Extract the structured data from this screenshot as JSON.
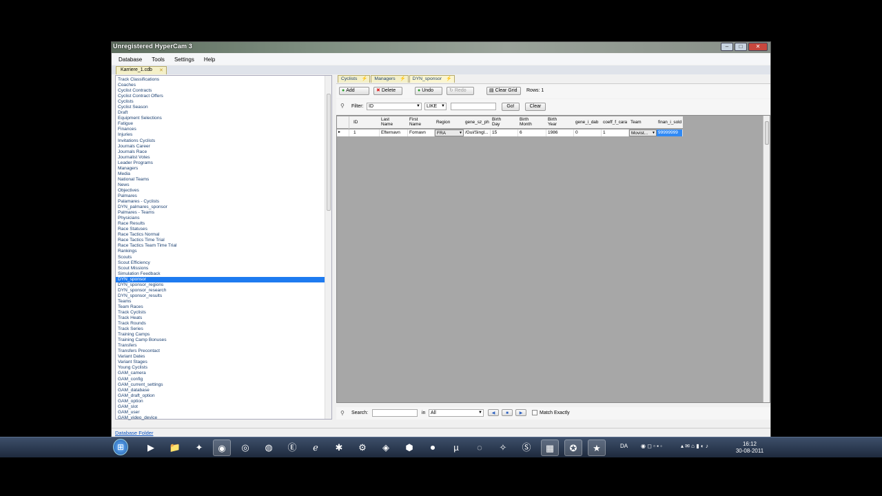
{
  "window": {
    "title": "Unregistered HyperCam 3",
    "caption_minimize": "–",
    "caption_maximize": "□",
    "caption_close": "✕"
  },
  "menu": [
    "Database",
    "Tools",
    "Settings",
    "Help"
  ],
  "file_tab": {
    "label": "Karriere_1.cdb",
    "close": "✕"
  },
  "tables": [
    "Track Classifications",
    "Coaches",
    "Cyclist Contracts",
    "Cyclist Contract Offers",
    "Cyclists",
    "Cyclist Season",
    "Draft",
    "Equipment Selections",
    "Fatigue",
    "Finances",
    "Injuries",
    "Invitations Cyclists",
    "Journals Career",
    "Journals Race",
    "Journalist Votes",
    "Leader Programs",
    "Managers",
    "Media",
    "National Teams",
    "News",
    "Objectives",
    "Palmares",
    "Palamares - Cyclists",
    "DYN_palmares_sponsor",
    "Palmares - Teams",
    "Physicians",
    "Race Results",
    "Race Statuses",
    "Race Tactics Normal",
    "Race Tactics Time Trial",
    "Race Tactics Team Time Trial",
    "Rankings",
    "Scouts",
    "Scout Efficiency",
    "Scout Missions",
    "Simulation Feedback",
    "DYN_sponsor",
    "DYN_sponsor_regions",
    "DYN_sponsor_research",
    "DYN_sponsor_results",
    "Teams",
    "Team Races",
    "Track Cyclists",
    "Track Heats",
    "Track Rounds",
    "Track Series",
    "Training Camps",
    "Training Camp Bonuses",
    "Transfers",
    "Transfers Precontact",
    "Variant Dates",
    "Variant Stages",
    "Young Cyclists",
    "GAM_camera",
    "GAM_config",
    "GAM_current_settings",
    "GAM_database",
    "GAM_draft_option",
    "GAM_option",
    "GAM_slot",
    "GAM_user",
    "GAM_video_device"
  ],
  "selected_index": 36,
  "doc_tabs": [
    {
      "label": "Cyclists",
      "active": false
    },
    {
      "label": "Managers",
      "active": false
    },
    {
      "label": "DYN_sponsor",
      "active": true
    }
  ],
  "toolbar": {
    "add": "Add",
    "delete": "Delete",
    "undo": "Undo",
    "redo": "Redo",
    "clear_grid": "Clear Grid",
    "rows": "Rows: 1"
  },
  "filter": {
    "label": "Filter:",
    "field": "ID",
    "operator": "LIKE",
    "value": "",
    "go": "Go!",
    "clear": "Clear"
  },
  "grid": {
    "headers": [
      "ID",
      "Last\nName",
      "First\nName",
      "Region",
      "gene_sz_ph",
      "Birth\nDay",
      "Birth\nMonth",
      "Birth\nYear",
      "gene_i_dab",
      "coeff_f_cara",
      "Team",
      "finan_i_sold"
    ],
    "row": [
      "1",
      "Efternavn",
      "Fornavn",
      "FRA",
      "/Gui/Singl...",
      "15",
      "6",
      "1986",
      "0",
      "1",
      "Movist...",
      "99999999"
    ]
  },
  "search": {
    "label": "Search:",
    "in": "in",
    "scope": "All",
    "match": "Match Exactly"
  },
  "status": {
    "link": "Database Folder"
  },
  "taskbar": {
    "lang": "DA",
    "time": "16:12",
    "date": "30-08-2011"
  }
}
